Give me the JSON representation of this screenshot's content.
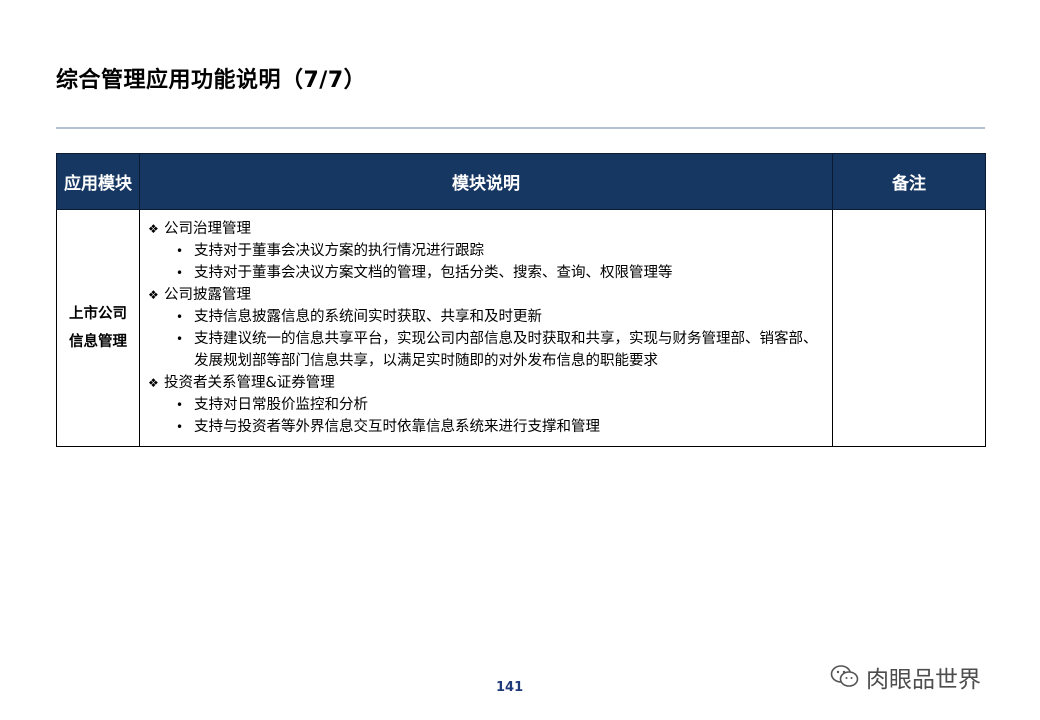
{
  "title": "综合管理应用功能说明（7/7）",
  "table": {
    "headers": [
      "应用模块",
      "模块说明",
      "备注"
    ],
    "module_lines": [
      "上市公司",
      "信息管理"
    ],
    "sections": [
      {
        "heading": "公司治理管理",
        "bullets": [
          "支持对于董事会决议方案的执行情况进行跟踪",
          "支持对于董事会决议方案文档的管理，包括分类、搜索、查询、权限管理等"
        ]
      },
      {
        "heading": "公司披露管理",
        "bullets": [
          "支持信息披露信息的系统间实时获取、共享和及时更新",
          "支持建议统一的信息共享平台，实现公司内部信息及时获取和共享，实现与财务管理部、销客部、发展规划部等部门信息共享，以满足实时随即的对外发布信息的职能要求"
        ]
      },
      {
        "heading": "投资者关系管理&证券管理",
        "bullets": [
          "支持对日常股价监控和分析",
          "支持与投资者等外界信息交互时依靠信息系统来进行支撑和管理"
        ]
      }
    ],
    "note": ""
  },
  "page_number": "141",
  "watermark": "肉眼品世界",
  "colors": {
    "header_bg": "#173763",
    "rule": "#b4c2d6"
  }
}
